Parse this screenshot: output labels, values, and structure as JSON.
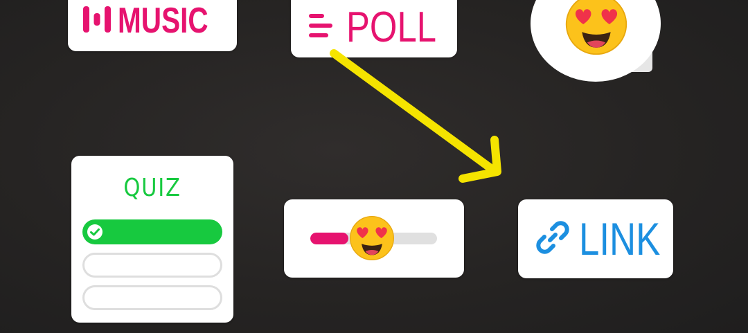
{
  "stickers": {
    "music": {
      "label": "MUSIC",
      "icon": "music-bars-icon",
      "color": "#e6136f"
    },
    "poll": {
      "label": "POLL",
      "icon": "poll-lines-icon",
      "color": "#e6136f"
    },
    "emoji_reaction": {
      "emoji": "heart-eyes-emoji",
      "icon": "heart-eyes-emoji"
    },
    "quiz": {
      "title": "QUIZ",
      "color": "#17c93f",
      "options": [
        {
          "state": "correct",
          "icon": "check-icon"
        },
        {
          "state": "empty"
        },
        {
          "state": "empty"
        }
      ]
    },
    "emoji_slider": {
      "emoji": "heart-eyes-emoji",
      "value": 0.3,
      "fill_color": "#e6136f"
    },
    "link": {
      "label": "LINK",
      "icon": "link-chain-icon",
      "color": "#1c8fe0"
    }
  },
  "annotation": {
    "type": "arrow",
    "color": "#f5e400",
    "from": "poll-sticker",
    "to": "link-sticker"
  }
}
